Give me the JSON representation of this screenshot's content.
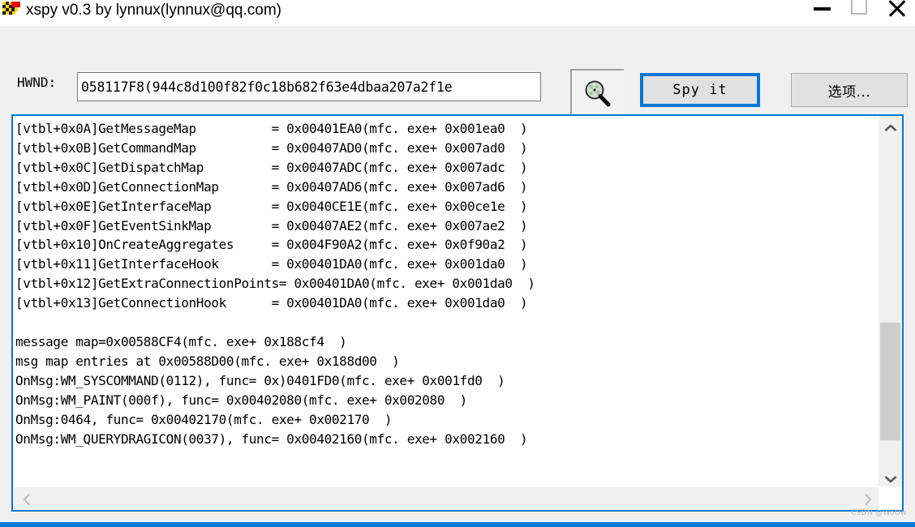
{
  "window": {
    "title": "xspy v0.3 by lynnux(lynnux@qq.com)",
    "icon": "xspy-app-icon",
    "controls": {
      "minimize": "minimize-icon",
      "maximize": "maximize-icon",
      "close": "close-icon"
    }
  },
  "toolbar": {
    "hwnd_label": "HWND:",
    "hwnd_value": "058117F8(944c8d100f82f0c18b682f63e4dbaa207a2f1e",
    "hwnd_placeholder": "",
    "magnifier_icon": "magnifier-icon",
    "spy_label": "Spy it",
    "options_label": "选项..."
  },
  "output": {
    "text": "[vtbl+0x0A]GetMessageMap          = 0x00401EA0(mfc. exe+ 0x001ea0  )\n[vtbl+0x0B]GetCommandMap          = 0x00407AD0(mfc. exe+ 0x007ad0  )\n[vtbl+0x0C]GetDispatchMap         = 0x00407ADC(mfc. exe+ 0x007adc  )\n[vtbl+0x0D]GetConnectionMap       = 0x00407AD6(mfc. exe+ 0x007ad6  )\n[vtbl+0x0E]GetInterfaceMap        = 0x0040CE1E(mfc. exe+ 0x00ce1e  )\n[vtbl+0x0F]GetEventSinkMap        = 0x00407AE2(mfc. exe+ 0x007ae2  )\n[vtbl+0x10]OnCreateAggregates     = 0x004F90A2(mfc. exe+ 0x0f90a2  )\n[vtbl+0x11]GetInterfaceHook       = 0x00401DA0(mfc. exe+ 0x001da0  )\n[vtbl+0x12]GetExtraConnectionPoints= 0x00401DA0(mfc. exe+ 0x001da0  )\n[vtbl+0x13]GetConnectionHook      = 0x00401DA0(mfc. exe+ 0x001da0  )\n\nmessage map=0x00588CF4(mfc. exe+ 0x188cf4  )\nmsg map entries at 0x00588D00(mfc. exe+ 0x188d00  )\nOnMsg:WM_SYSCOMMAND(0112), func= 0x)0401FD0(mfc. exe+ 0x001fd0  )\nOnMsg:WM_PAINT(000f), func= 0x00402080(mfc. exe+ 0x002080  )\nOnMsg:0464, func= 0x00402170(mfc. exe+ 0x002170  )\nOnMsg:WM_QUERYDRAGICON(0037), func= 0x00402160(mfc. exe+ 0x002160  )",
    "vscroll": {
      "up_icon": "chevron-up-icon",
      "down_icon": "chevron-down-icon"
    },
    "hscroll": {
      "left_icon": "chevron-left-icon",
      "right_icon": "chevron-right-icon"
    }
  },
  "watermark": "CSDN @WoOw",
  "colors": {
    "accent": "#0078d7",
    "window_bg": "#f0f0f0",
    "panel_bg": "#ffffff",
    "button_bg": "#e1e1e1",
    "scroll_thumb": "#cdcdcd"
  }
}
